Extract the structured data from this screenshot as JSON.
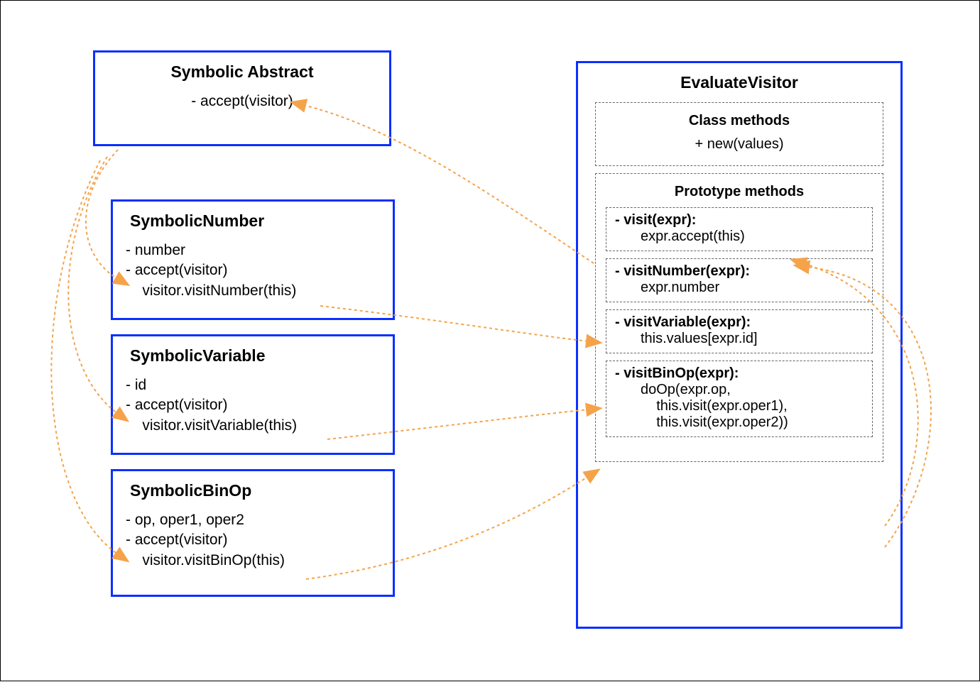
{
  "abstract": {
    "title": "Symbolic Abstract",
    "line1": "- accept(visitor)"
  },
  "number": {
    "title": "SymbolicNumber",
    "line1": "- number",
    "line2": "- accept(visitor)",
    "line3": "    visitor.visitNumber(this)"
  },
  "variable": {
    "title": "SymbolicVariable",
    "line1": "- id",
    "line2": "- accept(visitor)",
    "line3": "    visitor.visitVariable(this)"
  },
  "binop": {
    "title": "SymbolicBinOp",
    "line1": "- op, oper1, oper2",
    "line2": "- accept(visitor)",
    "line3": "    visitor.visitBinOp(this)"
  },
  "visitor": {
    "title": "EvaluateVisitor",
    "classMethods": {
      "heading": "Class methods",
      "method": "+ new(values)"
    },
    "protoMethods": {
      "heading": "Prototype methods",
      "visit": {
        "sig": "- visit(expr):",
        "body": "expr.accept(this)"
      },
      "visitNumber": {
        "sig": "- visitNumber(expr):",
        "body": "expr.number"
      },
      "visitVariable": {
        "sig": "- visitVariable(expr):",
        "body": "this.values[expr.id]"
      },
      "visitBinOp": {
        "sig": "- visitBinOp(expr):",
        "body": "doOp(expr.op,\n    this.visit(expr.oper1),\n    this.visit(expr.oper2))"
      }
    }
  }
}
